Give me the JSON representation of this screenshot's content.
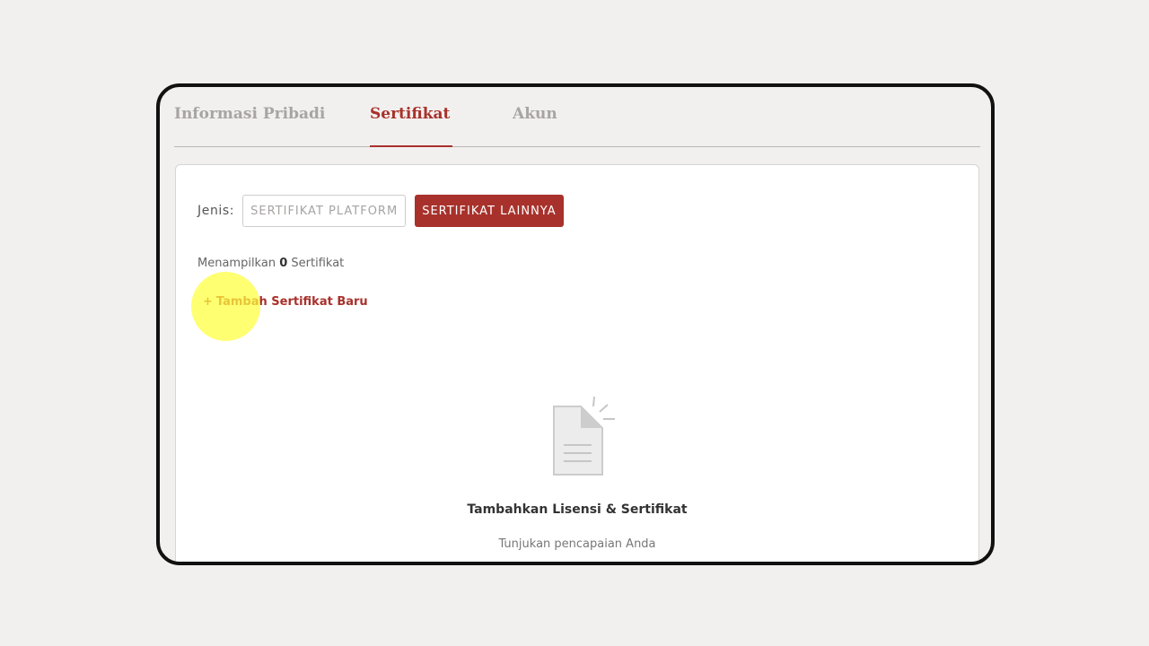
{
  "tabs": [
    {
      "label": "Informasi Pribadi",
      "active": false
    },
    {
      "label": "Sertifikat",
      "active": true
    },
    {
      "label": "Akun",
      "active": false
    }
  ],
  "filter": {
    "label": "Jenis:",
    "options": [
      "SERTIFIKAT PLATFORM",
      "SERTIFIKAT LAINNYA"
    ],
    "selected": "SERTIFIKAT LAINNYA"
  },
  "summary": {
    "prefix": "Menampilkan",
    "count": "0",
    "suffix": "Sertifikat"
  },
  "add_link": {
    "icon": "+",
    "label": "Tambah Sertifikat Baru"
  },
  "empty_state": {
    "icon": "document-icon",
    "title": "Tambahkan Lisensi & Sertifikat",
    "subtitle": "Tunjukan pencapaian Anda"
  },
  "colors": {
    "accent": "#a8312b",
    "background": "#f1f0ef",
    "highlight": "#ffff3c"
  }
}
